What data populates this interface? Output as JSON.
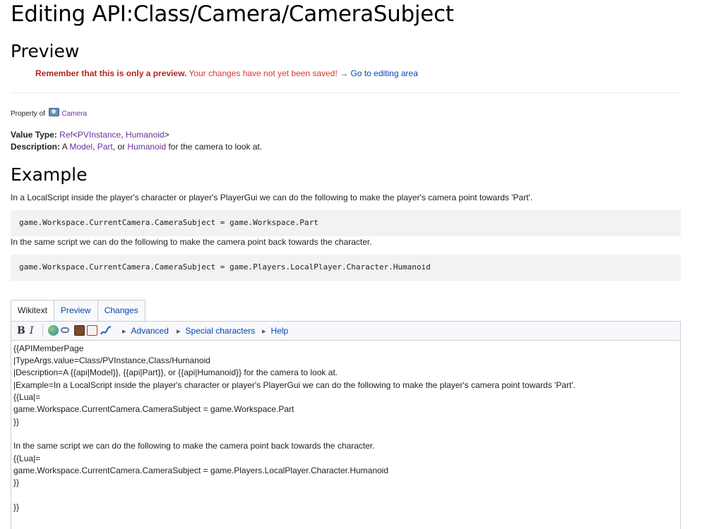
{
  "page": {
    "title": "Editing API:Class/Camera/CameraSubject",
    "preview_heading": "Preview",
    "example_heading": "Example"
  },
  "notice": {
    "bold": "Remember that this is only a preview.",
    "rest": " Your changes have not yet been saved!",
    "link": "→ Go to editing area"
  },
  "property": {
    "label": "Property of",
    "class_icon": "camera-icon",
    "class_link": "Camera"
  },
  "value_type": {
    "label": "Value Type:",
    "ref": "Ref",
    "lt": "<",
    "type1": "PVInstance",
    "comma": ", ",
    "type2": "Humanoid",
    "gt": ">"
  },
  "description": {
    "label": "Description:",
    "a": " A ",
    "link1": "Model",
    "sep1": ", ",
    "link2": "Part",
    "sep2": ", or ",
    "link3": "Humanoid",
    "tail": " for the camera to look at."
  },
  "example": {
    "intro": "In a LocalScript inside the player's character or player's PlayerGui we can do the following to make the player's camera point towards 'Part'.",
    "code1": "game.Workspace.CurrentCamera.CameraSubject = game.Workspace.Part",
    "between": "In the same script we can do the following to make the camera point back towards the character.",
    "code2": "game.Workspace.CurrentCamera.CameraSubject = game.Players.LocalPlayer.Character.Humanoid"
  },
  "editor": {
    "tabs": [
      "Wikitext",
      "Preview",
      "Changes"
    ],
    "toolbar": {
      "bold": "B",
      "italic": "I",
      "icons": [
        "globe-link-icon",
        "link-icon",
        "image-icon",
        "pdf-icon",
        "signature-icon"
      ],
      "advanced": "Advanced",
      "special": "Special characters",
      "help": "Help"
    },
    "lines": [
      "{{APIMemberPage",
      "|TypeArgs.value=Class/PVInstance,Class/Humanoid",
      "|Description=A {{api|Model}}, {{api|Part}}, or {{api|Humanoid}} for the camera to look at.",
      "|Example=In a LocalScript inside the player's character or player's PlayerGui we can do the following to make the player's camera point towards 'Part'.",
      "{{Lua|=",
      "game.Workspace.CurrentCamera.CameraSubject = game.Workspace.Part",
      "}}",
      "",
      "In the same script we can do the following to make the camera point back towards the character.",
      "{{Lua|=",
      "game.Workspace.CurrentCamera.CameraSubject = game.Players.LocalPlayer.Character.Humanoid",
      "}}",
      "",
      "}}"
    ]
  },
  "colors": {
    "link": "#0645ad",
    "visited_link": "#6b2fa3",
    "notice_red": "#d33",
    "code_bg": "#f2f2f2"
  }
}
